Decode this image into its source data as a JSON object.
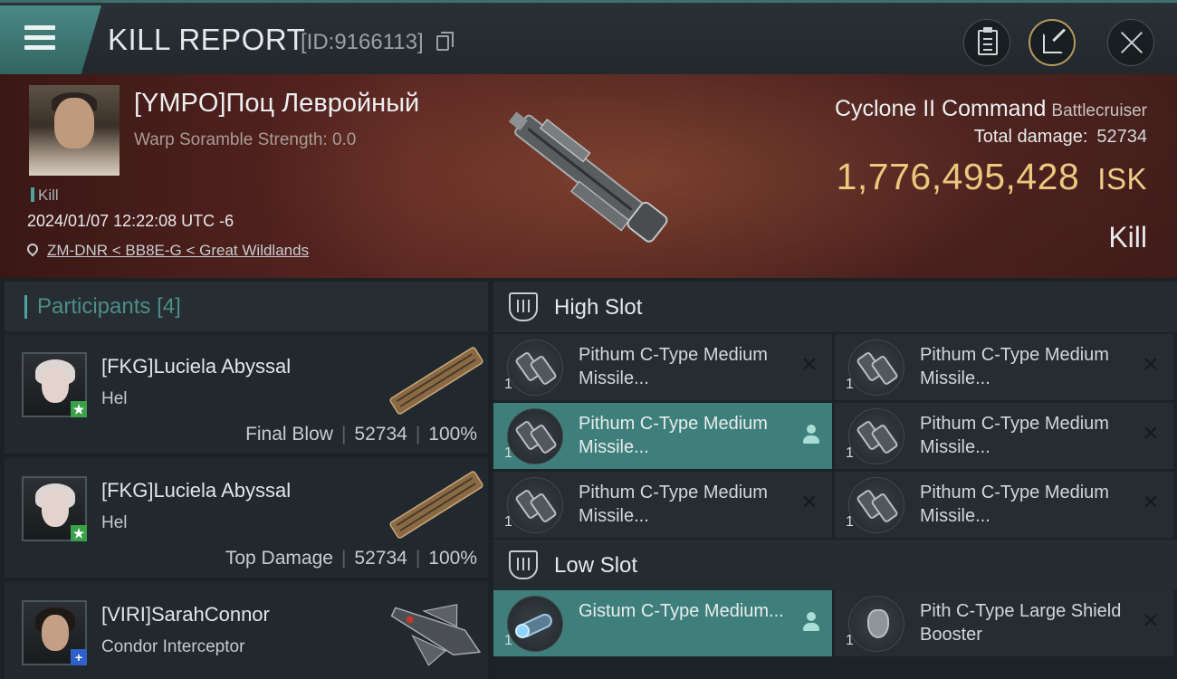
{
  "header": {
    "title": "KILL REPORT",
    "id_text": "[ID:9166113]"
  },
  "victim": {
    "name": "[YMPO]Поц Левройный",
    "warp_scramble": "Warp Soramble Strength: 0.0",
    "tag": "Kill",
    "datetime": "2024/01/07 12:22:08 UTC -6",
    "location": "ZM-DNR < BB8E-G < Great Wildlands",
    "ship_name": "Cyclone II Command",
    "ship_class": "Battlecruiser",
    "total_damage_label": "Total damage:",
    "total_damage": "52734",
    "isk_value": "1,776,495,428",
    "isk_unit": "ISK",
    "result": "Kill"
  },
  "participants": {
    "title": "Participants",
    "count": "[4]",
    "items": [
      {
        "name": "[FKG]Luciela Abyssal",
        "ship": "Hel",
        "role": "Final Blow",
        "damage": "52734",
        "percent": "100%",
        "badge": "★",
        "badge_color": "#3aa14a"
      },
      {
        "name": "[FKG]Luciela Abyssal",
        "ship": "Hel",
        "role": "Top Damage",
        "damage": "52734",
        "percent": "100%",
        "badge": "★",
        "badge_color": "#3aa14a"
      },
      {
        "name": "[VIRI]SarahConnor",
        "ship": "Condor Interceptor",
        "badge": "+",
        "badge_color": "#2f62c9"
      }
    ]
  },
  "high_slot": {
    "title": "High Slot",
    "modules": [
      {
        "name": "Pithum C-Type Medium Missile...",
        "qty": "1",
        "status": "destroyed"
      },
      {
        "name": "Pithum C-Type Medium Missile...",
        "qty": "1",
        "status": "destroyed"
      },
      {
        "name": "Pithum C-Type Medium Missile...",
        "qty": "1",
        "status": "dropped"
      },
      {
        "name": "Pithum C-Type Medium Missile...",
        "qty": "1",
        "status": "destroyed"
      },
      {
        "name": "Pithum C-Type Medium Missile...",
        "qty": "1",
        "status": "destroyed"
      },
      {
        "name": "Pithum C-Type Medium Missile...",
        "qty": "1",
        "status": "destroyed"
      }
    ]
  },
  "low_slot": {
    "title": "Low Slot",
    "modules": [
      {
        "name": "Gistum C-Type Medium...",
        "qty": "1",
        "status": "dropped"
      },
      {
        "name": "Pith C-Type Large Shield Booster",
        "qty": "1",
        "status": "destroyed"
      }
    ]
  },
  "icons": {
    "menu": "hamburger-icon",
    "copy": "copy-icon",
    "clipboard": "clipboard-icon",
    "share": "share-icon",
    "close": "close-icon",
    "location": "location-pin-icon",
    "slot": "slot-rack-icon",
    "destroyed": "x-icon",
    "dropped": "pilot-icon"
  },
  "colors": {
    "accent_teal": "#4fa39f",
    "isk_gold": "#ecc77e",
    "victim_banner": "#5a2622",
    "highlight_cell": "#3f7f7b"
  }
}
